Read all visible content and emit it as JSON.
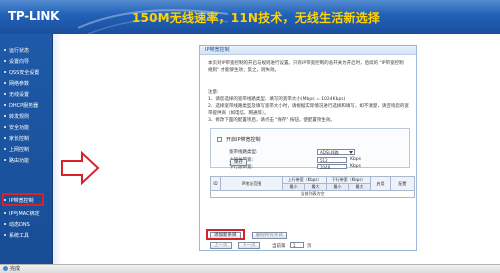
{
  "header": {
    "logo": "TP-LINK",
    "slogan": "150M无线速率，11N技术，无线生活新选择"
  },
  "sidebar": {
    "items": [
      {
        "label": "运行状态"
      },
      {
        "label": "设置向导"
      },
      {
        "label": "QSS安全设置"
      },
      {
        "label": "网络参数"
      },
      {
        "label": "无线设置"
      },
      {
        "label": "DHCP服务器"
      },
      {
        "label": "转发规则"
      },
      {
        "label": "安全功能"
      },
      {
        "label": "家长控制"
      },
      {
        "label": "上网控制"
      },
      {
        "label": "路由功能"
      },
      {
        "label": "IP带宽控制",
        "active": true
      },
      {
        "label": "IP与MAC绑定"
      },
      {
        "label": "动态DNS"
      },
      {
        "label": "系统工具"
      }
    ]
  },
  "panel": {
    "title": "IP带宽控制",
    "description": "本页对IP带宽控制的开启与规则进行设置。只有IP带宽控制的总开关为开启时，后续的 \"IP带宽控制规则\" 才能够生效；反之，则失效。",
    "notes_title": "注意:",
    "notes": [
      "1、请您选择的宽带线路类型、填写的宽带大小(Mbps = 1024Kbps)",
      "2、选择宽带线路类型及填写宽带大小时，请根据实际情况进行选择和填写，如不清楚，请咨询您的宽带提供商（如电信、网通等）。",
      "3、修改下面的配置项后，请点击 \"保存\" 按钮，使配置项生效。"
    ],
    "enable_label": "开启IP带宽控制",
    "line_type_label": "宽带线路类型:",
    "line_type_value": "ADSL线路",
    "uplink_label": "上行总带宽:",
    "uplink_value": "512",
    "downlink_label": "下行总带宽:",
    "downlink_value": "2048",
    "unit": "Kbps",
    "save_button": "保存"
  },
  "table": {
    "headers": {
      "id": "ID",
      "ip_range": "IP地址范围",
      "up": "上行带宽（Kbps）",
      "down": "下行带宽（Kbps）",
      "enabled": "启用",
      "config": "配置",
      "min": "最小",
      "max": "最大"
    },
    "empty_text": "当前列表为空",
    "add_button": "添加新条目",
    "delete_all_button": "删除所有条目",
    "prev_button": "上一页",
    "next_button": "下一页",
    "page_label": "当前第",
    "page_value": "1",
    "page_suffix": "页"
  },
  "statusbar": {
    "text": "完成"
  },
  "colors": {
    "header_blue": "#1f5db3",
    "slogan_yellow": "#ffd200",
    "highlight_red": "#d8222a"
  }
}
